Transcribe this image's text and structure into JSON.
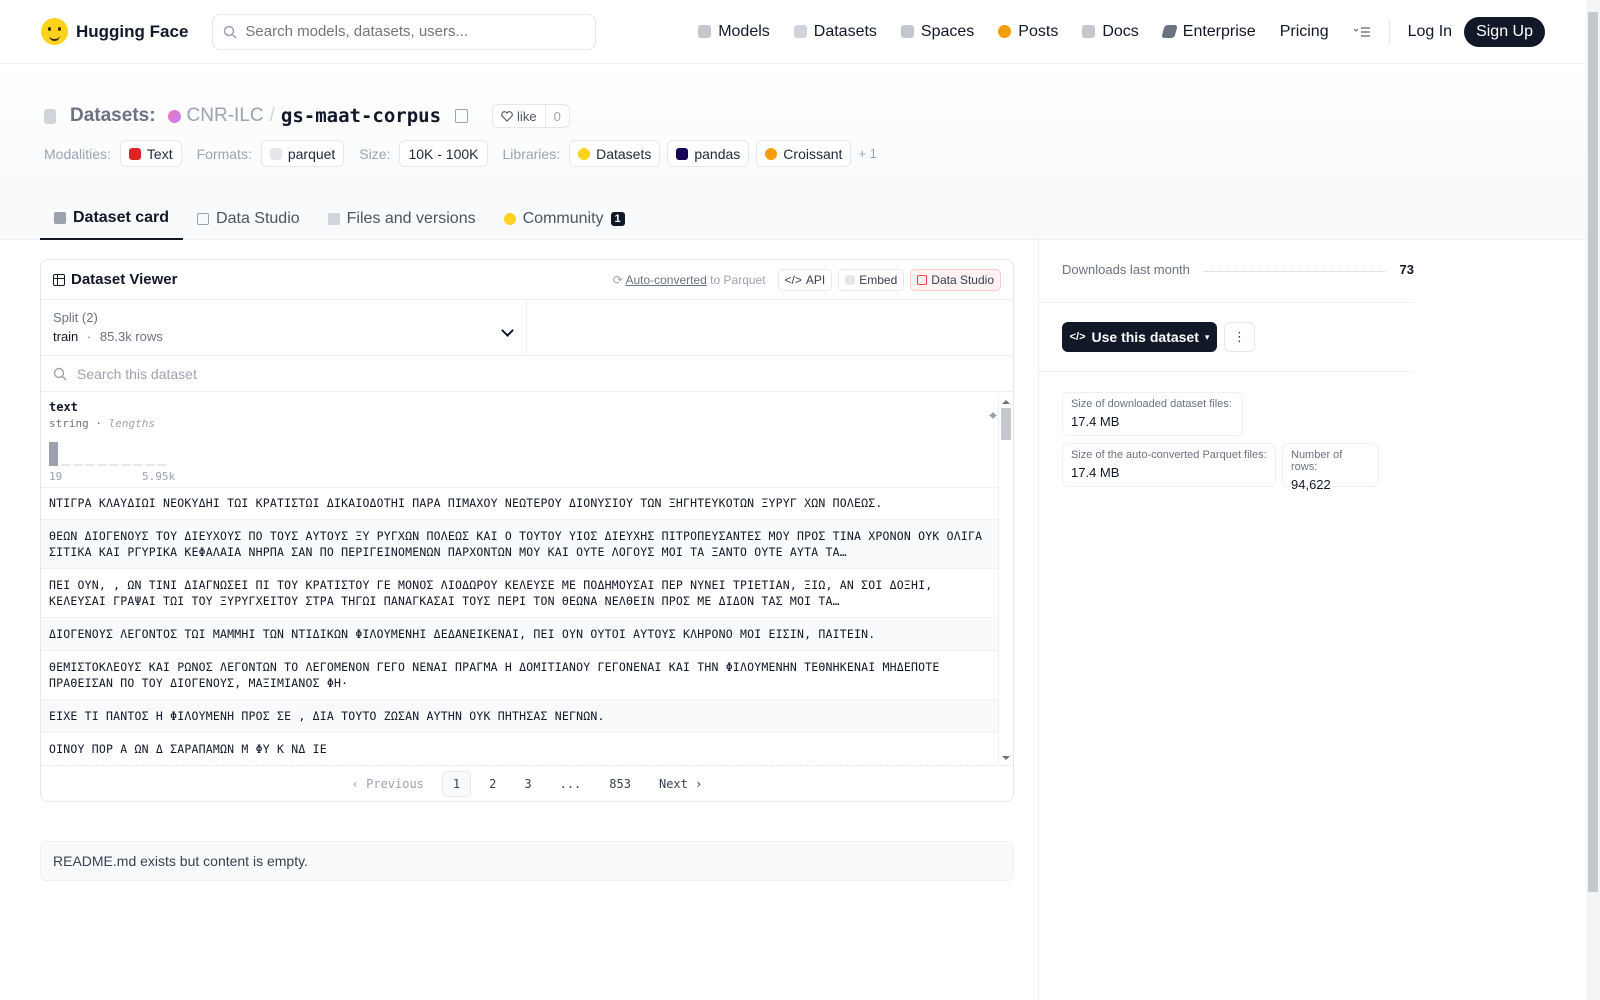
{
  "nav": {
    "brand": "Hugging Face",
    "search_placeholder": "Search models, datasets, users...",
    "items": [
      {
        "label": "Models",
        "icon": "cube-icon",
        "color": "#9ca3af"
      },
      {
        "label": "Datasets",
        "icon": "database-icon",
        "color": "#d1d5db"
      },
      {
        "label": "Spaces",
        "icon": "grid-icon",
        "color": "#c4c7cc"
      },
      {
        "label": "Posts",
        "icon": "post-icon",
        "color": "#f59e0b"
      },
      {
        "label": "Docs",
        "icon": "book-icon",
        "color": "#9ca3af"
      },
      {
        "label": "Enterprise",
        "icon": "enterprise-icon",
        "color": "#6b7280"
      },
      {
        "label": "Pricing",
        "icon": "",
        "color": ""
      }
    ],
    "login": "Log In",
    "signup": "Sign Up"
  },
  "header": {
    "prefix": "Datasets:",
    "org": "CNR-ILC",
    "sep": "/",
    "name": "gs-maat-corpus",
    "like_label": "like",
    "like_count": "0",
    "tags": {
      "modalities_label": "Modalities:",
      "modality": "Text",
      "formats_label": "Formats:",
      "format": "parquet",
      "size_label": "Size:",
      "size": "10K - 100K",
      "libraries_label": "Libraries:",
      "lib1": "Datasets",
      "lib2": "pandas",
      "lib3": "Croissant",
      "more": "+ 1"
    },
    "tabs": [
      {
        "label": "Dataset card"
      },
      {
        "label": "Data Studio"
      },
      {
        "label": "Files and versions"
      },
      {
        "label": "Community",
        "badge": "1"
      }
    ]
  },
  "viewer": {
    "title": "Dataset Viewer",
    "auto_converted": "Auto-converted",
    "to_parquet": "to Parquet",
    "api": "API",
    "embed": "Embed",
    "data_studio": "Data Studio",
    "split_label": "Split (2)",
    "split_name": "train",
    "split_dot": "·",
    "split_rows": "85.3k rows",
    "search_placeholder": "Search this dataset",
    "col_name": "text",
    "col_type": "string",
    "col_sep": "·",
    "col_stat": "lengths",
    "hist_min": "19",
    "hist_max": "5.95k",
    "hist_values": [
      1.0,
      0.05,
      0.05,
      0.05,
      0.05,
      0.05,
      0.05,
      0.05,
      0.05,
      0.05
    ],
    "rows": [
      "ΝΤΙΓΡΑ ΚΛΑΥΔΙΩΙ ΝΕΟΚΥΔΗΙ ΤΩΙ ΚΡΑΤΙΣΤΩΙ ΔΙΚΑΙΟΔΟΤΗΙ ΠΑΡΑ ΠΙΜΑΧΟΥ ΝΕΩΤΕΡΟΥ ΔΙΟΝΥΣΙΟΥ ΤΩΝ ΞΗΓΗΤΕΥΚΟΤΩΝ ΞΥΡΥΓ ΧΩΝ ΠΟΛΕΩΣ.",
      "ΘΕΩΝ ΔΙΟΓΕΝΟΥΣ ΤΟΥ ΔΙΕΥΧΟΥΣ ΠΟ ΤΟΥΣ ΑΥΤΟΥΣ ΞΥ ΡΥΓΧΩΝ ΠΟΛΕΩΣ ΚΑΙ Ο ΤΟΥΤΟΥ ΥΙΟΣ ΔΙΕΥΧΗΣ ΠΙΤΡΟΠΕΥΣΑΝΤΕΣ ΜΟΥ ΠΡΟΣ ΤΙΝΑ ΧΡΟΝΟΝ ΟΥΚ ΟΛΙΓΑ ΣΙΤΙΚΑ ΚΑΙ ΡΓΥΡΙΚΑ ΚΕΦΑΛΑΙΑ ΝΗΡΠΑ ΣΑΝ ΠΟ ΠΕΡΙΓΕΙΝΟΜΕΝΩΝ ΠΑΡΧΟΝΤΩΝ ΜΟΥ ΚΑΙ ΟΥΤΕ ΛΟΓΟΥΣ ΜΟΙ ΤΑ ΞΑΝΤΟ ΟΥΤΕ ΑΥΤΑ ΤΑ…",
      "ΠΕΙ ΟΥΝ, , ΩΝ ΤΙΝΙ ΔΙΑΓΝΩΣΕΙ ΠΙ ΤΟΥ ΚΡΑΤΙΣΤΟΥ ΓΕ ΜΟΝΟΣ ΛΙΟΔΩΡΟΥ ΚΕΛΕΥΣΕ ΜΕ ΠΟΔΗΜΟΥΣΑΙ ΠΕΡ ΝΥΝΕΙ ΤΡΙΕΤΙΑΝ, ΞΙΩ, ΑΝ ΣΟΙ ΔΟΞΗΙ, ΚΕΛΕΥΣΑΙ ΓΡΑΨΑΙ ΤΩΙ ΤΟΥ ΞΥΡΥΓΧΕΙΤΟΥ ΣΤΡΑ ΤΗΓΩΙ ΠΑΝΑΓΚΑΣΑΙ ΤΟΥΣ ΠΕΡΙ ΤΟΝ ΘΕΩΝΑ ΝΕΛΘΕΙΝ ΠΡΟΣ ΜΕ ΔΙΔΟΝ ΤΑΣ ΜΟΙ ΤΑ…",
      "ΔΙΟΓΕΝΟΥΣ ΛΕΓΟΝΤΟΣ ΤΩΙ ΜΑΜΜΗΙ ΤΩΝ ΝΤΙΔΙΚΩΝ ΦΙΛΟΥΜΕΝΗΙ ΔΕΔΑΝΕΙΚΕΝΑΙ, ΠΕΙ ΟΥΝ ΟΥΤΟΙ ΑΥΤΟΥΣ ΚΛΗΡΟΝΟ ΜΟΙ ΕΙΣΙΝ, ΠΑΙΤΕΙΝ.",
      "ΘΕΜΙΣΤΟΚΛΕΟΥΣ ΚΑΙ ΡΩΝΟΣ ΛΕΓΟΝΤΩΝ ΤΟ ΛΕΓΟΜΕΝΟΝ ΓΕΓΟ ΝΕΝΑΙ ΠΡΑΓΜΑ Η ΔΟΜΙΤΙΑΝΟΥ ΓΕΓΟΝΕΝΑΙ ΚΑΙ ΤΗΝ ΦΙΛΟΥΜΕΝΗΝ ΤΕΘΝΗΚΕΝΑΙ ΜΗΔΕΠΟΤΕ ΠΡΑΘΕΙΣΑΝ ΠΟ ΤΟΥ ΔΙΟΓΕΝΟΥΣ, ΜΑΞΙΜΙΑΝΟΣ ΦΗ·",
      "ΕΙΧΕ ΤΙ ΠΑΝΤΟΣ Η ΦΙΛΟΥΜΕΝΗ ΠΡΟΣ ΣΕ , ΔΙΑ ΤΟΥΤΟ ΖΩΣΑΝ ΑΥΤΗΝ ΟΥΚ ΠΗΤΗΣΑΣ ΝΕΓΝΩΝ.",
      "ΟΙΝΟΥ ΠΟΡ Α ΩΝ Δ ΣΑΡΑΠΑΜΩΝ Μ ΦΥ Κ ΝΔ ΙΕ"
    ],
    "pager": {
      "prev": "Previous",
      "pages": [
        "1",
        "2",
        "3",
        "...",
        "853"
      ],
      "next": "Next"
    }
  },
  "readme": "README.md exists but content is empty.",
  "sidebar": {
    "downloads_label": "Downloads last month",
    "downloads_value": "73",
    "use_button": "Use this dataset",
    "stats": [
      {
        "label": "Size of downloaded dataset files:",
        "value": "17.4 MB"
      },
      {
        "label": "Size of the auto-converted Parquet files:",
        "value": "17.4 MB"
      },
      {
        "label": "Number of rows:",
        "value": "94,622"
      }
    ]
  }
}
